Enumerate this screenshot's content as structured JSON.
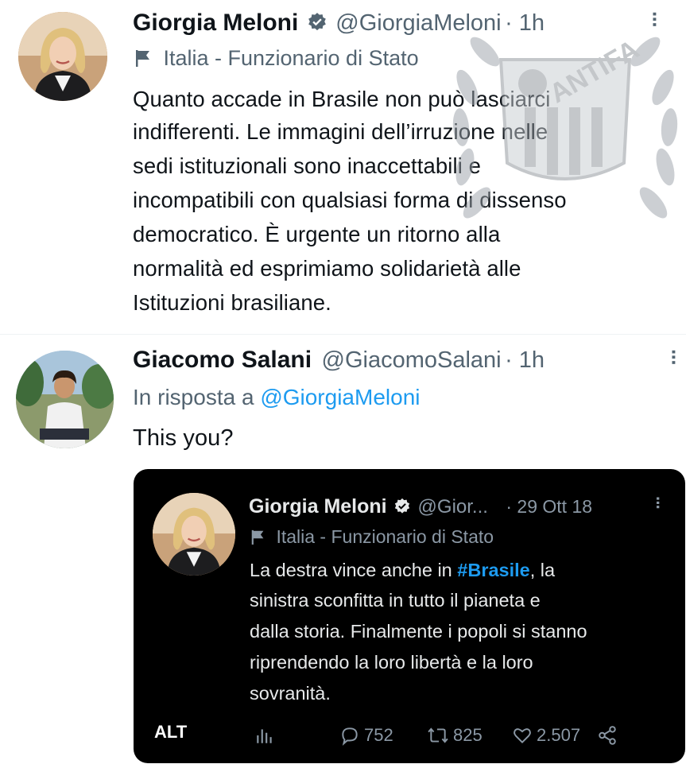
{
  "tweet1": {
    "name": "Giorgia Meloni",
    "handle": "@GiorgiaMeloni",
    "time": "· 1h",
    "label": "Italia - Funzionario di Stato",
    "lines": [
      "Quanto accade in Brasile non può lasciarci",
      "indifferenti. Le immagini dell’irruzione nelle",
      "sedi istituzionali sono inaccettabili e",
      "incompatibili con qualsiasi forma di dissenso",
      "democratico. È urgente un ritorno alla",
      "normalità ed esprimiamo solidarietà alle",
      "Istituzioni brasiliane."
    ]
  },
  "tweet2": {
    "name": "Giacomo Salani",
    "handle": "@GiacomoSalani",
    "time": "· 1h",
    "reply_prefix": "In risposta a",
    "reply_to": "@GiorgiaMeloni",
    "text": "This you?"
  },
  "quote": {
    "name": "Giorgia Meloni",
    "handle": "@Gior...",
    "time": "· 29 Ott 18",
    "label": "Italia - Funzionario di Stato",
    "line1_prefix": "La destra vince anche in",
    "hashtag": "#Brasile",
    "line1_suffix": ", la",
    "lines": [
      "sinistra sconfitta in tutto il pianeta e",
      "dalla storia. Finalmente i popoli si stanno",
      "riprendendo la loro libertà e la loro",
      "sovranità."
    ],
    "alt": "ALT",
    "replies": "752",
    "retweets": "825",
    "likes": "2.507"
  },
  "watermark_text": "ANTIFA",
  "colors": {
    "accent": "#1d9bf0",
    "text_primary": "#0f1419",
    "text_secondary": "#536471",
    "dark_bg": "#000000",
    "dark_text": "#e7e9ea",
    "dark_secondary": "#8b98a5"
  }
}
